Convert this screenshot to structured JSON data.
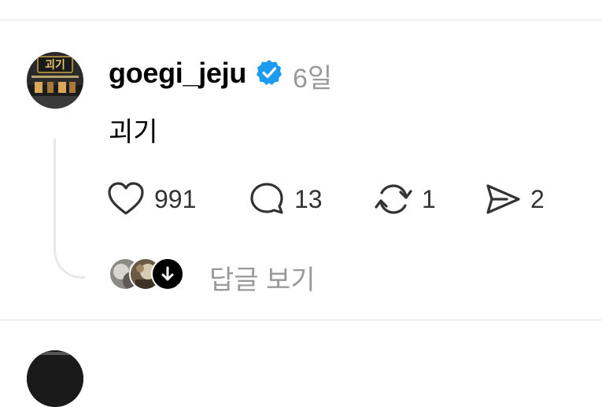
{
  "post": {
    "username": "goegi_jeju",
    "age": "6일",
    "text": "괴기",
    "avatar_sign": "괴기"
  },
  "actions": {
    "likes": "991",
    "comments": "13",
    "reposts": "1",
    "shares": "2"
  },
  "replies": {
    "label": "답글 보기"
  },
  "icons": {
    "verified": "verified-badge-icon",
    "like": "heart-icon",
    "comment": "comment-bubble-icon",
    "repost": "repost-icon",
    "share": "paper-plane-icon",
    "expand": "arrow-down-icon"
  },
  "colors": {
    "verified": "#1d9bf0",
    "muted_text": "#999999",
    "divider": "#e6e6e6"
  }
}
